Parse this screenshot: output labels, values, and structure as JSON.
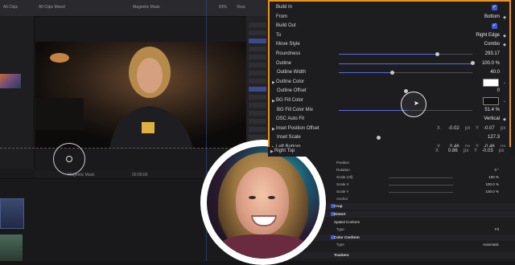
{
  "editor": {
    "library_label": "All Clips",
    "clip_label": "All Clips Mixed",
    "project_name": "Magnetic Mask",
    "zoom": "83%",
    "view_label": "View",
    "timeline_clip": "Magnetic Mask",
    "timecode": "00:00:00"
  },
  "panel": {
    "build_in": {
      "label": "Build In",
      "checked": true
    },
    "from": {
      "label": "From",
      "value": "Bottom"
    },
    "build_out": {
      "label": "Build Out",
      "checked": true
    },
    "to": {
      "label": "To",
      "value": "Right Edge"
    },
    "move_style": {
      "label": "Move Style",
      "value": "Combo"
    },
    "roundness": {
      "label": "Roundness",
      "value": "293.17",
      "level": 0.74
    },
    "outline": {
      "label": "Outline",
      "value": "100.0 %",
      "level": 1.0
    },
    "outline_width": {
      "label": "Outline Width",
      "value": "40.0",
      "level": 0.4
    },
    "outline_color": {
      "label": "Outline Color",
      "color": "#ffffff"
    },
    "outline_offset": {
      "label": "Outline Offset",
      "value": "0",
      "level": 0.5
    },
    "bg_fill_color": {
      "label": "BG Fill Color",
      "color": "#111111"
    },
    "bg_fill_color_mix": {
      "label": "BG Fill Color Mix",
      "value": "51.4 %",
      "level": 0.514
    },
    "osc_auto_fit": {
      "label": "OSC Auto Fit",
      "value": "Vertical"
    },
    "inset_position_offset": {
      "label": "Inset Position Offset",
      "x_label": "X",
      "x": "-0.02",
      "x_unit": "px",
      "y_label": "Y",
      "y": "-0.07",
      "y_unit": "px"
    },
    "inset_scale": {
      "label": "Inset Scale",
      "value": "127.3",
      "level": 0.3
    },
    "left_bottom": {
      "label": "Left Bottom",
      "x_label": "X",
      "x": "0.46",
      "x_unit": "px",
      "y_label": "Y",
      "y": "-0.46",
      "y_unit": "px"
    },
    "right_top": {
      "label": "Right Top",
      "x_label": "X",
      "x": "0.86",
      "x_unit": "px",
      "y_label": "Y",
      "y": "-0.03",
      "y_unit": "px"
    }
  },
  "inspector2": {
    "position": {
      "label": "Position"
    },
    "rotation": {
      "label": "Rotation",
      "value": "0 °"
    },
    "scale_all": {
      "label": "Scale (All)",
      "value": "100 %"
    },
    "scale_x": {
      "label": "Scale X",
      "value": "100.0 %"
    },
    "scale_y": {
      "label": "Scale Y",
      "value": "100.0 %"
    },
    "anchor": {
      "label": "Anchor"
    },
    "crop": {
      "label": "Crop"
    },
    "distort": {
      "label": "Distort"
    },
    "spatial_conform": {
      "label": "Spatial Conform"
    },
    "type1": {
      "label": "Type",
      "value": "Fit"
    },
    "color_conform": {
      "label": "Color Conform"
    },
    "type2": {
      "label": "Type",
      "value": "Automatic"
    },
    "trackers": {
      "label": "Trackers"
    }
  }
}
